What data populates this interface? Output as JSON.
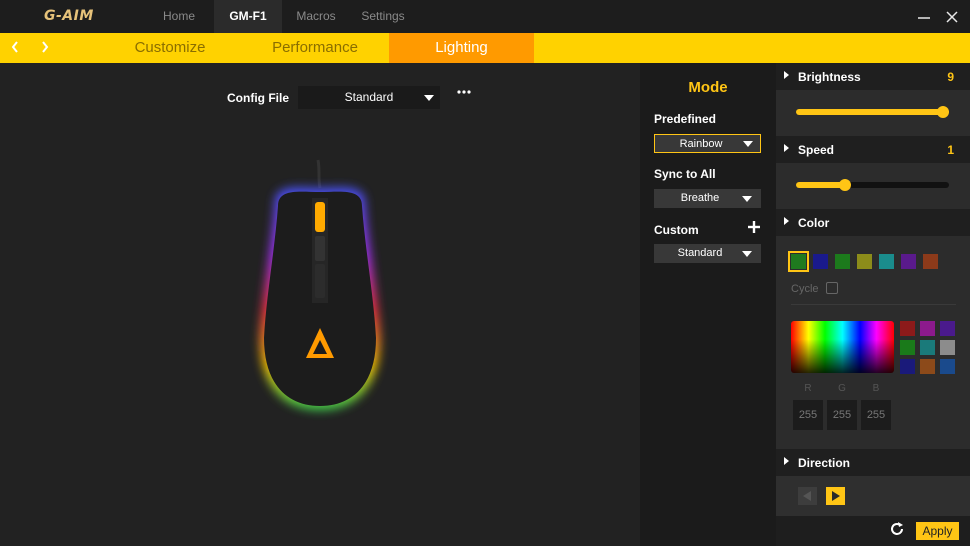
{
  "app": {
    "logo": "G-AIM"
  },
  "nav": {
    "tabs": [
      {
        "label": "Home",
        "active": false
      },
      {
        "label": "GM-F1",
        "active": true
      },
      {
        "label": "Macros",
        "active": false
      },
      {
        "label": "Settings",
        "active": false
      }
    ]
  },
  "window": {
    "minimize_icon": "minimize-icon",
    "close_icon": "close-icon"
  },
  "subnav": {
    "prev_icon": "chevron-left-icon",
    "next_icon": "chevron-right-icon",
    "tabs": [
      {
        "label": "Customize",
        "active": false
      },
      {
        "label": "Performance",
        "active": false
      },
      {
        "label": "Lighting",
        "active": true
      }
    ]
  },
  "config": {
    "label": "Config File",
    "value": "Standard",
    "more_icon": "more-icon"
  },
  "mode": {
    "title": "Mode",
    "predefined": {
      "label": "Predefined",
      "value": "Rainbow"
    },
    "sync": {
      "label": "Sync to All",
      "value": "Breathe"
    },
    "custom": {
      "label": "Custom",
      "value": "Standard",
      "add_icon": "plus-icon"
    }
  },
  "brightness": {
    "label": "Brightness",
    "value": "9",
    "level_fraction": 1.0
  },
  "speed": {
    "label": "Speed",
    "value": "1",
    "level_fraction": 0.32
  },
  "color": {
    "label": "Color",
    "swatches": [
      "#1f7a1f",
      "#1a1a8c",
      "#1c7a1c",
      "#8c8c1a",
      "#1a8c8c",
      "#5a1a8c",
      "#8c3a1a"
    ],
    "selected_swatch": 0,
    "cycle_label": "Cycle",
    "palette": [
      "#8c1a1a",
      "#8c1a8c",
      "#4a1a8c",
      "#1a7a1a",
      "#1a7a7a",
      "#8c8c8c",
      "#1a1a7a",
      "#8c4a1a",
      "#1a4a8c"
    ],
    "rgb": {
      "r_label": "R",
      "g_label": "G",
      "b_label": "B",
      "r": "255",
      "g": "255",
      "b": "255"
    }
  },
  "direction": {
    "label": "Direction",
    "left_icon": "play-left-icon",
    "right_icon": "play-right-icon",
    "selected": "right"
  },
  "footer": {
    "reset_icon": "refresh-icon",
    "apply_label": "Apply"
  },
  "colors": {
    "accent": "#ffc515",
    "tab_yellow": "#ffd200",
    "tab_active": "#ff9a00"
  }
}
